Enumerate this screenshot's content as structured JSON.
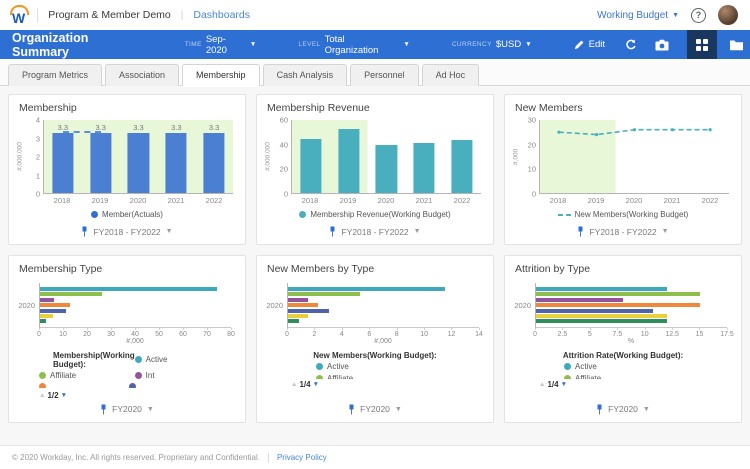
{
  "topbar": {
    "app_title": "Program & Member Demo",
    "dashboards_link": "Dashboards",
    "working_budget_label": "Working Budget"
  },
  "header": {
    "title": "Organization Summary",
    "time_label": "TIME",
    "time_value": "Sep-2020",
    "level_label": "LEVEL",
    "level_value": "Total Organization",
    "currency_label": "CURRENCY",
    "currency_value": "$USD",
    "edit_label": "Edit"
  },
  "tabs": [
    {
      "label": "Program Metrics",
      "active": false
    },
    {
      "label": "Association",
      "active": false
    },
    {
      "label": "Membership",
      "active": true
    },
    {
      "label": "Cash Analysis",
      "active": false
    },
    {
      "label": "Personnel",
      "active": false
    },
    {
      "label": "Ad Hoc",
      "active": false
    }
  ],
  "colors": {
    "header_blue": "#2e6fd3",
    "bar_blue": "#4b7fd2",
    "teal": "#49afbe",
    "green_region_bg": "#e9f7d9",
    "series_active": "#3fa9bc",
    "series_affiliate": "#8cbf4c",
    "series_int": "#94549c",
    "series_orange": "#f0883c",
    "series_indigo": "#4f62ae",
    "series_yellow": "#e7d03b",
    "series_dark_green": "#2e8e5c"
  },
  "chart_data": [
    {
      "type": "bar",
      "title": "Membership",
      "categories": [
        "2018",
        "2019",
        "2020",
        "2021",
        "2022"
      ],
      "values": [
        3.3,
        3.3,
        3.3,
        3.3,
        3.3
      ],
      "bar_labels": [
        "3.3",
        "3.3",
        "3.3",
        "3.3",
        "3.3"
      ],
      "ylabel": "#,000,000",
      "yticks": [
        0,
        1,
        2,
        3,
        4
      ],
      "ylim": [
        0,
        4
      ],
      "bar_color": "#4b7fd2",
      "green_region": "full",
      "dashed_segment": {
        "from": 0,
        "to": 1,
        "value": 3.3,
        "color": "#5b8ee0"
      },
      "legend": {
        "layout": "center",
        "entries": [
          {
            "label": "Member(Actuals)",
            "color": "#2f6fd4",
            "marker": "dot"
          }
        ]
      },
      "footer": "FY2018 - FY2022"
    },
    {
      "type": "bar",
      "title": "Membership Revenue",
      "categories": [
        "2018",
        "2019",
        "2020",
        "2021",
        "2022"
      ],
      "values": [
        44,
        53,
        39.5,
        41.5,
        43.5
      ],
      "ylabel": "#,000,000",
      "yticks": [
        0,
        20,
        40,
        60
      ],
      "ylim": [
        0,
        60
      ],
      "bar_color": "#49afbe",
      "green_region": "left",
      "legend": {
        "layout": "center",
        "entries": [
          {
            "label": "Membership Revenue(Working Budget)",
            "color": "#49afbe",
            "marker": "dot"
          }
        ]
      },
      "footer": "FY2018 - FY2022"
    },
    {
      "type": "line",
      "title": "New Members",
      "categories": [
        "2018",
        "2019",
        "2020",
        "2021",
        "2022"
      ],
      "values": [
        25,
        24,
        26,
        26,
        26
      ],
      "ylabel": "#,000",
      "yticks": [
        0,
        10,
        20,
        30
      ],
      "ylim": [
        0,
        30
      ],
      "line_color": "#49afbe",
      "green_region": "left",
      "legend": {
        "layout": "center",
        "entries": [
          {
            "label": "New Members(Working Budget)",
            "color": "#49afbe",
            "marker": "dashed"
          }
        ]
      },
      "footer": "FY2018 - FY2022"
    },
    {
      "type": "hbar",
      "title": "Membership Type",
      "category": "2020",
      "series": [
        {
          "name": "Active",
          "value": 74,
          "color": "#3fa9bc"
        },
        {
          "name": "Affiliate",
          "value": 26,
          "color": "#8cbf4c"
        },
        {
          "name": "Int",
          "value": 6,
          "color": "#94549c"
        },
        {
          "name": "",
          "value": 12.5,
          "color": "#f0883c"
        },
        {
          "name": "",
          "value": 11,
          "color": "#4f62ae"
        },
        {
          "name": "",
          "value": 5.5,
          "color": "#e7d03b"
        },
        {
          "name": "",
          "value": 2.5,
          "color": "#2e8e5c"
        }
      ],
      "xlabel": "#,000",
      "xticks": [
        0,
        10,
        20,
        30,
        40,
        50,
        60,
        70,
        80
      ],
      "xlim": [
        0,
        80
      ],
      "legend": {
        "layout": "two-col",
        "header": "Membership(Working Budget):",
        "entries": [
          {
            "label": "Active",
            "color": "#3fa9bc",
            "marker": "dot"
          },
          {
            "label": "Affiliate",
            "color": "#8cbf4c",
            "marker": "dot"
          },
          {
            "label": "Int",
            "color": "#94549c",
            "marker": "dot"
          }
        ],
        "clipped": [
          {
            "label": "",
            "color": "#f0883c",
            "marker": "dot"
          },
          {
            "label": "",
            "color": "#4f62ae",
            "marker": "dot"
          }
        ],
        "pagination": "1/2"
      },
      "footer": "FY2020"
    },
    {
      "type": "hbar",
      "title": "New Members by Type",
      "category": "2020",
      "series": [
        {
          "name": "Active",
          "value": 11.5,
          "color": "#3fa9bc"
        },
        {
          "name": "Affiliate",
          "value": 5.3,
          "color": "#8cbf4c"
        },
        {
          "name": "",
          "value": 1.5,
          "color": "#94549c"
        },
        {
          "name": "",
          "value": 2.2,
          "color": "#f0883c"
        },
        {
          "name": "",
          "value": 3,
          "color": "#4f62ae"
        },
        {
          "name": "",
          "value": 1.5,
          "color": "#e7d03b"
        },
        {
          "name": "",
          "value": 0.8,
          "color": "#2e8e5c"
        }
      ],
      "xlabel": "#,000",
      "xticks": [
        0,
        2,
        4,
        6,
        8,
        10,
        12,
        14
      ],
      "xlim": [
        0,
        14
      ],
      "legend": {
        "layout": "col",
        "header": "New Members(Working Budget):",
        "entries": [
          {
            "label": "Active",
            "color": "#3fa9bc",
            "marker": "dot"
          }
        ],
        "clipped": [
          {
            "label": "Affiliate",
            "color": "#8cbf4c",
            "marker": "dot"
          }
        ],
        "pagination": "1/4"
      },
      "footer": "FY2020"
    },
    {
      "type": "hbar",
      "title": "Attrition by Type",
      "category": "2020",
      "series": [
        {
          "name": "Active",
          "value": 12,
          "color": "#3fa9bc"
        },
        {
          "name": "Affiliate",
          "value": 15,
          "color": "#8cbf4c"
        },
        {
          "name": "",
          "value": 8,
          "color": "#94549c"
        },
        {
          "name": "",
          "value": 15,
          "color": "#f0883c"
        },
        {
          "name": "",
          "value": 10.7,
          "color": "#4f62ae"
        },
        {
          "name": "",
          "value": 12,
          "color": "#e7d03b"
        },
        {
          "name": "",
          "value": 12,
          "color": "#2e8e5c"
        }
      ],
      "xlabel": "%",
      "xticks": [
        0,
        2.5,
        5,
        7.5,
        10,
        12.5,
        15,
        17.5
      ],
      "xlim": [
        0,
        17.5
      ],
      "legend": {
        "layout": "col",
        "header": "Attrition Rate(Working Budget):",
        "entries": [
          {
            "label": "Active",
            "color": "#3fa9bc",
            "marker": "dot"
          }
        ],
        "clipped": [
          {
            "label": "Affiliate",
            "color": "#8cbf4c",
            "marker": "dot"
          }
        ],
        "pagination": "1/4"
      },
      "footer": "FY2020"
    }
  ],
  "page_footer": {
    "copyright": "© 2020 Workday, Inc. All rights reserved. Proprietary and Confidential.",
    "privacy_link": "Privacy Policy"
  }
}
